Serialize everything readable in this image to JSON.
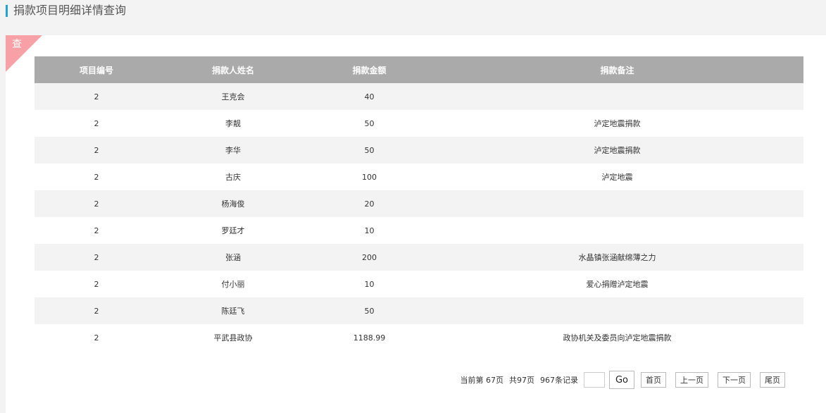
{
  "header": {
    "title": "捐款项目明细详情查询"
  },
  "corner": {
    "label": "查"
  },
  "table": {
    "columns": [
      "项目编号",
      "捐款人姓名",
      "捐款金额",
      "捐款备注"
    ],
    "rows": [
      {
        "id": "2",
        "name": "王克会",
        "amount": "40",
        "note": ""
      },
      {
        "id": "2",
        "name": "李靓",
        "amount": "50",
        "note": "泸定地震捐款"
      },
      {
        "id": "2",
        "name": "李华",
        "amount": "50",
        "note": "泸定地震捐款"
      },
      {
        "id": "2",
        "name": "古庆",
        "amount": "100",
        "note": "泸定地震"
      },
      {
        "id": "2",
        "name": "杨海俊",
        "amount": "20",
        "note": ""
      },
      {
        "id": "2",
        "name": "罗廷才",
        "amount": "10",
        "note": ""
      },
      {
        "id": "2",
        "name": "张涵",
        "amount": "200",
        "note": "水晶镇张涵献绵薄之力"
      },
      {
        "id": "2",
        "name": "付小丽",
        "amount": "10",
        "note": "爱心捐赠泸定地震"
      },
      {
        "id": "2",
        "name": "陈廷飞",
        "amount": "50",
        "note": ""
      },
      {
        "id": "2",
        "name": "平武县政协",
        "amount": "1188.99",
        "note": "政协机关及委员向泸定地震捐款"
      }
    ]
  },
  "pager": {
    "current": "当前第  67页",
    "total_pages": "共97页",
    "total_records": "967条记录",
    "goto_value": "",
    "go": "Go",
    "first": "首页",
    "prev": "上一页",
    "next": "下一页",
    "last": "尾页"
  }
}
